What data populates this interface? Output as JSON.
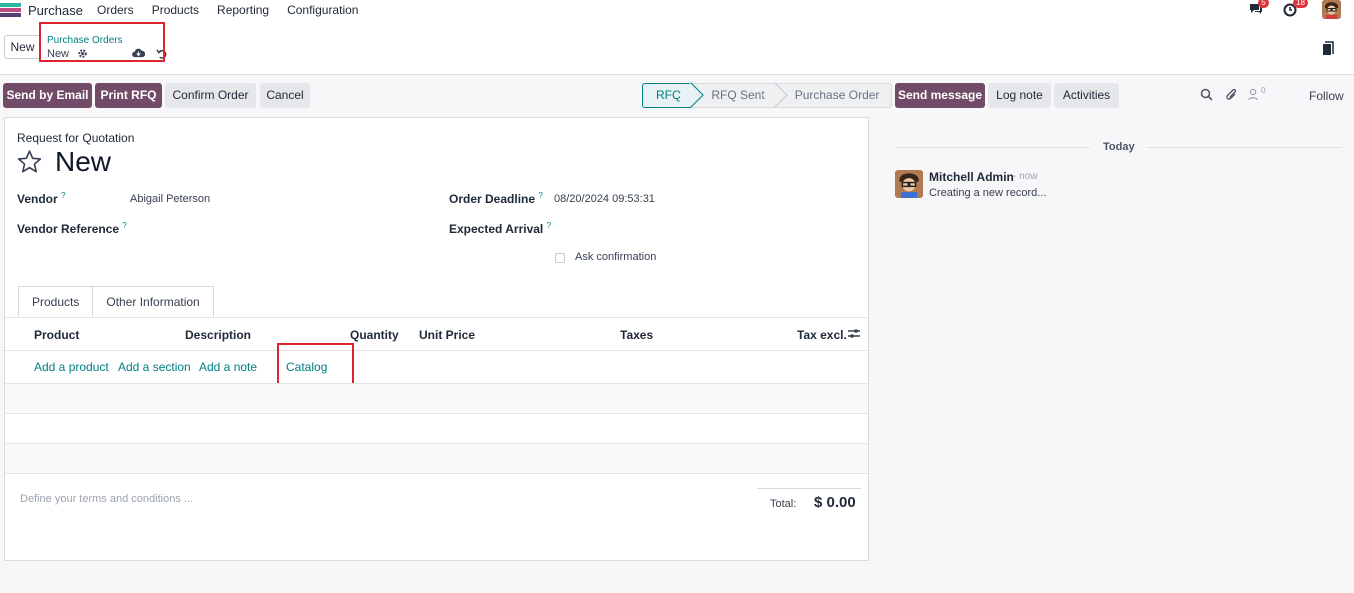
{
  "navbar": {
    "app_name": "Purchase",
    "menu": [
      "Orders",
      "Products",
      "Reporting",
      "Configuration"
    ],
    "messages_count": "5",
    "activities_count": "18"
  },
  "control": {
    "new_label": "New",
    "breadcrumb_parent": "Purchase Orders",
    "breadcrumb_current": "New"
  },
  "actions": {
    "send_email": "Send by Email",
    "print_rfq": "Print RFQ",
    "confirm_order": "Confirm Order",
    "cancel": "Cancel"
  },
  "statusbar": [
    "RFQ",
    "RFQ Sent",
    "Purchase Order"
  ],
  "form": {
    "subtitle": "Request for Quotation",
    "title": "New",
    "vendor_label": "Vendor",
    "vendor_value": "Abigail Peterson",
    "vendor_ref_label": "Vendor Reference",
    "order_deadline_label": "Order Deadline",
    "order_deadline_value": "08/20/2024 09:53:31",
    "expected_arrival_label": "Expected Arrival",
    "ask_confirmation_label": "Ask confirmation",
    "help_mark": "?"
  },
  "tabs": [
    "Products",
    "Other Information"
  ],
  "table": {
    "columns": [
      "Product",
      "Description",
      "Quantity",
      "Unit Price",
      "Taxes",
      "Tax excl."
    ],
    "add_product": "Add a product",
    "add_section": "Add a section",
    "add_note": "Add a note",
    "catalog": "Catalog"
  },
  "footer": {
    "terms_placeholder": "Define your terms and conditions ...",
    "total_label": "Total:",
    "total_value": "$ 0.00"
  },
  "chatter": {
    "send_message": "Send message",
    "log_note": "Log note",
    "activities": "Activities",
    "followers_count": "0",
    "follow": "Follow",
    "date_separator": "Today",
    "message_author": "Mitchell Admin",
    "message_time": "- now",
    "message_body": "Creating a new record..."
  },
  "colors": {
    "primary": "#714b67",
    "link": "#017e84",
    "highlight_box": "#e0232e"
  }
}
